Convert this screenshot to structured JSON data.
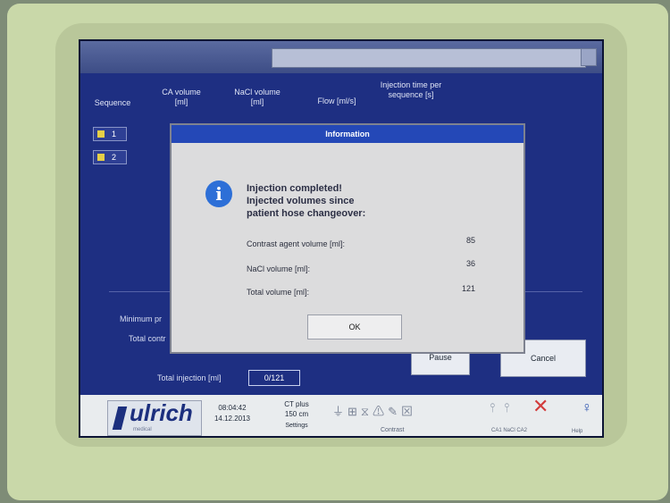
{
  "window": {
    "title": ""
  },
  "columns": {
    "sequence": "Sequence",
    "ca_volume": "CA volume [ml]",
    "nacl_volume": "NaCl volume [ml]",
    "flow": "Flow [ml/s]",
    "injection_time": "Injection time per sequence [s]"
  },
  "sequences": [
    {
      "label": "1"
    },
    {
      "label": "2"
    }
  ],
  "main": {
    "minimum_label": "Minimum pr",
    "total_contrast_label": "Total contr",
    "total_injection_label": "Total injection [ml]",
    "total_injection_value": "0/121",
    "pause_button": "Pause",
    "cancel_button": "Cancel"
  },
  "footer": {
    "logo_text": "ulrich",
    "logo_sub": "medical",
    "time": "08:04:42",
    "date": "14.12.2013",
    "mode_line1": "CT plus",
    "mode_line2": "150 cm",
    "settings_label": "Settings",
    "contrast_label": "Contrast",
    "status_label": "CA1  NaCl  CA2",
    "help_label": "Help"
  },
  "dialog": {
    "title": "Information",
    "message_line1": "Injection completed!",
    "message_line2": "Injected volumes since",
    "message_line3": "patient hose changeover:",
    "contrast_label": "Contrast agent volume [ml]:",
    "contrast_value": "85",
    "nacl_label": "NaCl volume [ml]:",
    "nacl_value": "36",
    "total_label": "Total volume [ml]:",
    "total_value": "121",
    "ok_button": "OK"
  },
  "colors": {
    "screen_bg": "#1e2f82",
    "dialog_title": "#2448b7",
    "info_icon": "#2d6fd7"
  }
}
